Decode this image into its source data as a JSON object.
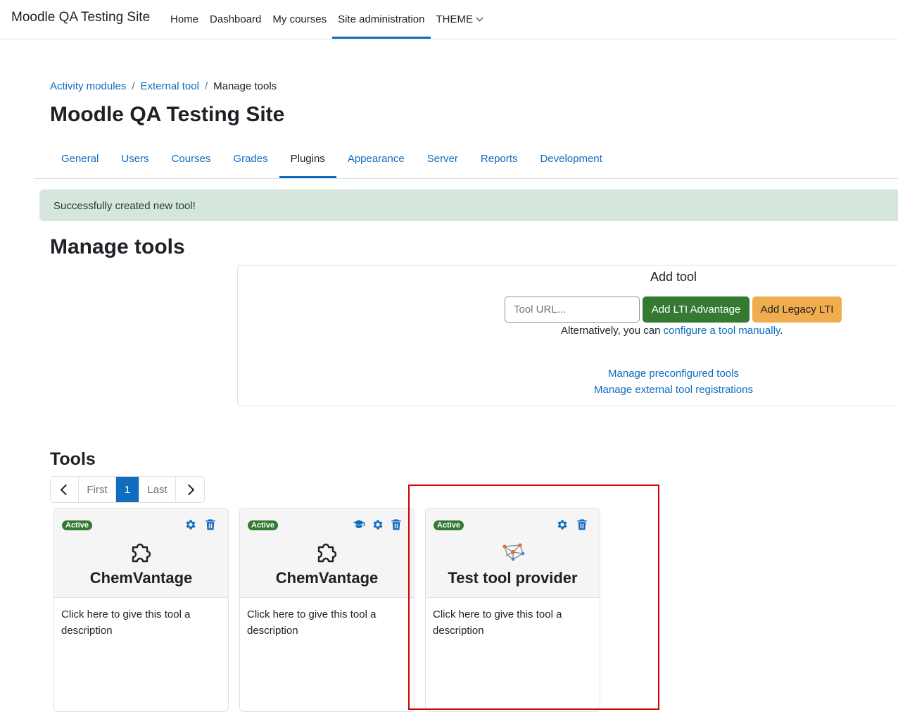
{
  "navbar": {
    "brand": "Moodle QA Testing Site",
    "items": [
      {
        "label": "Home"
      },
      {
        "label": "Dashboard"
      },
      {
        "label": "My courses"
      },
      {
        "label": "Site administration"
      },
      {
        "label": "THEME"
      }
    ]
  },
  "breadcrumb": [
    "Activity modules",
    "External tool",
    "Manage tools"
  ],
  "page_title": "Moodle QA Testing Site",
  "secondary_nav": [
    "General",
    "Users",
    "Courses",
    "Grades",
    "Plugins",
    "Appearance",
    "Server",
    "Reports",
    "Development"
  ],
  "alert": "Successfully created new tool!",
  "heading": "Manage tools",
  "add_tool": {
    "title": "Add tool",
    "input_placeholder": "Tool URL...",
    "lti_button": "Add LTI Advantage",
    "legacy_button": "Add Legacy LTI",
    "alt_prefix": "Alternatively, you can ",
    "alt_link": "configure a tool manually",
    "alt_suffix": ".",
    "link_preconfigured": "Manage preconfigured tools",
    "link_registrations": "Manage external tool registrations"
  },
  "tools_heading": "Tools",
  "pagination": {
    "first": "First",
    "current": "1",
    "last": "Last"
  },
  "cards": [
    {
      "status": "Active",
      "name": "ChemVantage",
      "description": "Click here to give this tool a description",
      "icon": "puzzle-icon"
    },
    {
      "status": "Active",
      "name": "ChemVantage",
      "description": "Click here to give this tool a description",
      "icon": "puzzle-icon"
    },
    {
      "status": "Active",
      "name": "Test tool provider",
      "description": "Click here to give this tool a description",
      "icon": "network-icon"
    }
  ],
  "colors": {
    "accent": "#0f6cbf",
    "success": "#357a32",
    "warning": "#f0ad4e",
    "alert_bg": "#d7e6dc",
    "highlight": "#d20000"
  }
}
